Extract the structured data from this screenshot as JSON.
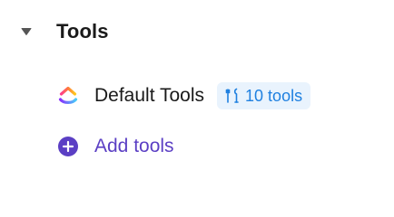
{
  "section": {
    "title": "Tools",
    "caret_icon": "caret-down-icon"
  },
  "tools": [
    {
      "name": "Default Tools",
      "logo_icon": "clickup-logo-icon",
      "badge": {
        "icon": "tools-icon",
        "label": "10 tools"
      }
    }
  ],
  "add_tools": {
    "icon": "plus-circle-icon",
    "label": "Add tools"
  },
  "colors": {
    "text": "#1a1a1a",
    "badge_bg": "#e9f3fd",
    "badge_text": "#1f80e0",
    "accent_purple": "#5b3fc4"
  }
}
